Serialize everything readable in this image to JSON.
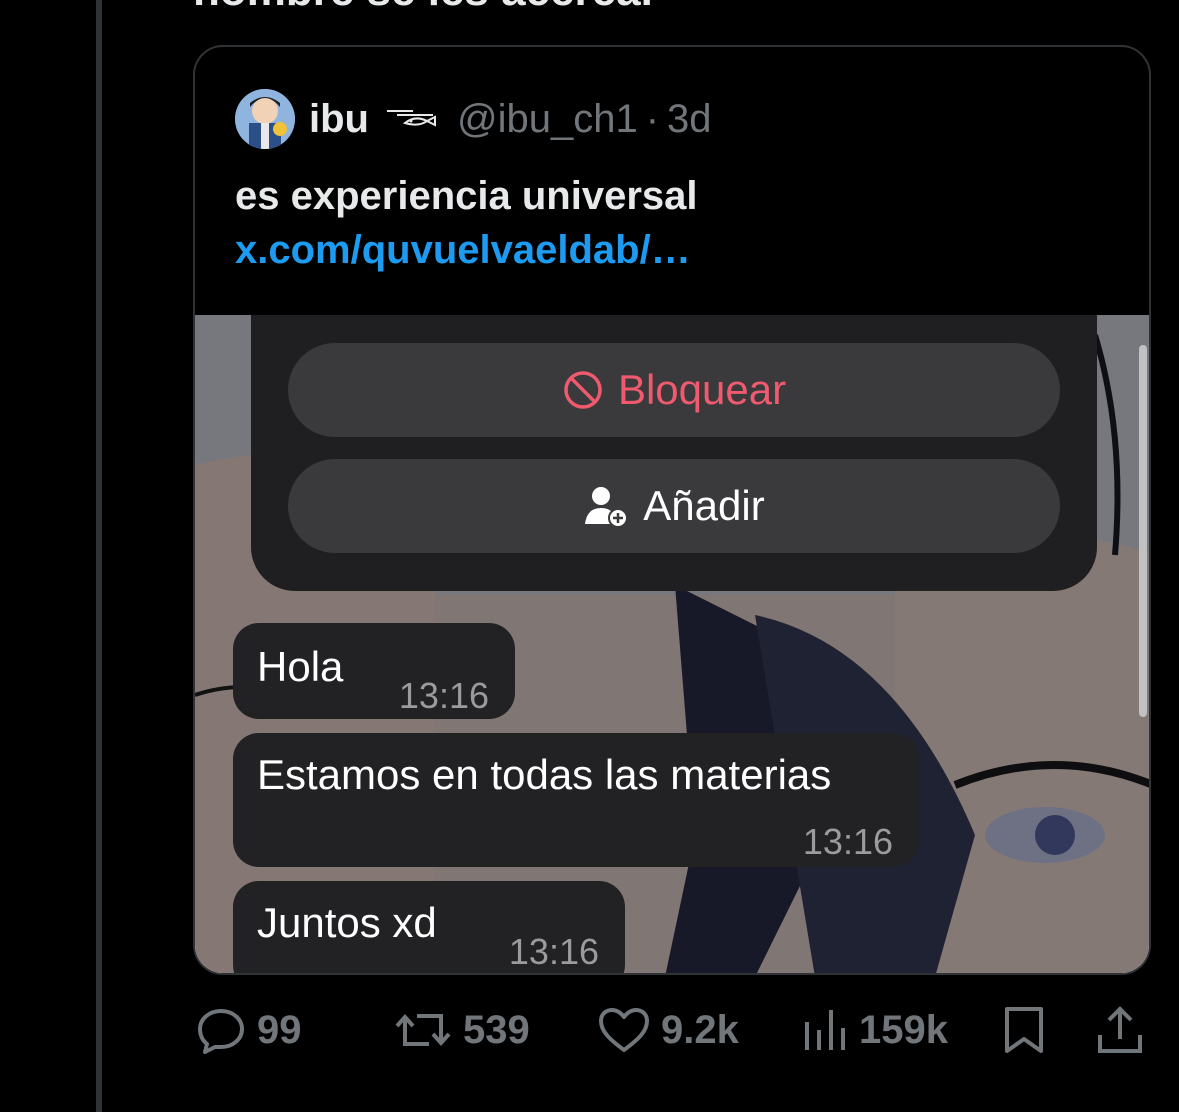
{
  "previous_tweet": {
    "text_fragment": "nombre se les acerca."
  },
  "quoted_tweet": {
    "display_name": "ibu",
    "handle": "@ibu_ch1",
    "separator": "·",
    "time": "3d",
    "text": "es experiencia universal ",
    "link_text": "x.com/quvuelvaeldab/…",
    "media": {
      "menu": {
        "block_label": "Bloquear",
        "add_label": "Añadir"
      },
      "messages": [
        {
          "text": "Hola",
          "time": "13:16"
        },
        {
          "text": "Estamos en todas las materias",
          "time": "13:16"
        },
        {
          "text": "Juntos xd",
          "time": "13:16"
        }
      ]
    }
  },
  "actions": {
    "replies": "99",
    "retweets": "539",
    "likes": "9.2k",
    "views": "159k"
  },
  "colors": {
    "background": "#000000",
    "link": "#1d9bf0",
    "muted": "#71767b",
    "block_red": "#ef5a6f"
  },
  "icons": [
    "reply-icon",
    "retweet-icon",
    "like-icon",
    "views-icon",
    "bookmark-icon",
    "share-icon",
    "block-icon",
    "add-contact-icon",
    "fish-icon"
  ]
}
